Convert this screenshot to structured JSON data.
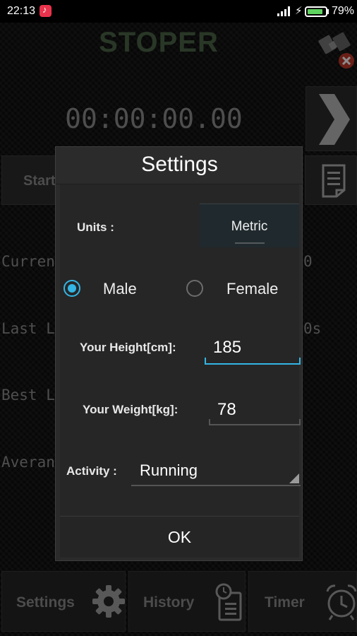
{
  "status_bar": {
    "time": "22:13",
    "battery": "79%"
  },
  "app": {
    "title": "STOPER",
    "timer": "00:00:00.00",
    "start_label": "Start",
    "stats": {
      "current_label": "Curren",
      "current_value": "0",
      "last_label": "Last L",
      "last_value": "0s",
      "best_label": "Best L",
      "average_label": "Averan"
    }
  },
  "bottom_nav": [
    {
      "label": "Settings",
      "icon": "gear-icon"
    },
    {
      "label": "History",
      "icon": "history-icon"
    },
    {
      "label": "Timer",
      "icon": "alarm-clock-icon"
    }
  ],
  "dialog": {
    "title": "Settings",
    "units_label": "Units :",
    "units_value": "Metric",
    "gender_options": [
      {
        "label": "Male",
        "selected": true
      },
      {
        "label": "Female",
        "selected": false
      }
    ],
    "height_label": "Your Height[cm]:",
    "height_value": "185",
    "weight_label": "Your Weight[kg]:",
    "weight_value": "78",
    "activity_label": "Activity :",
    "activity_value": "Running",
    "ok_label": "OK"
  },
  "colors": {
    "accent": "#33b5e5",
    "title_green": "#4b6548",
    "battery_green": "#5fd35f"
  }
}
